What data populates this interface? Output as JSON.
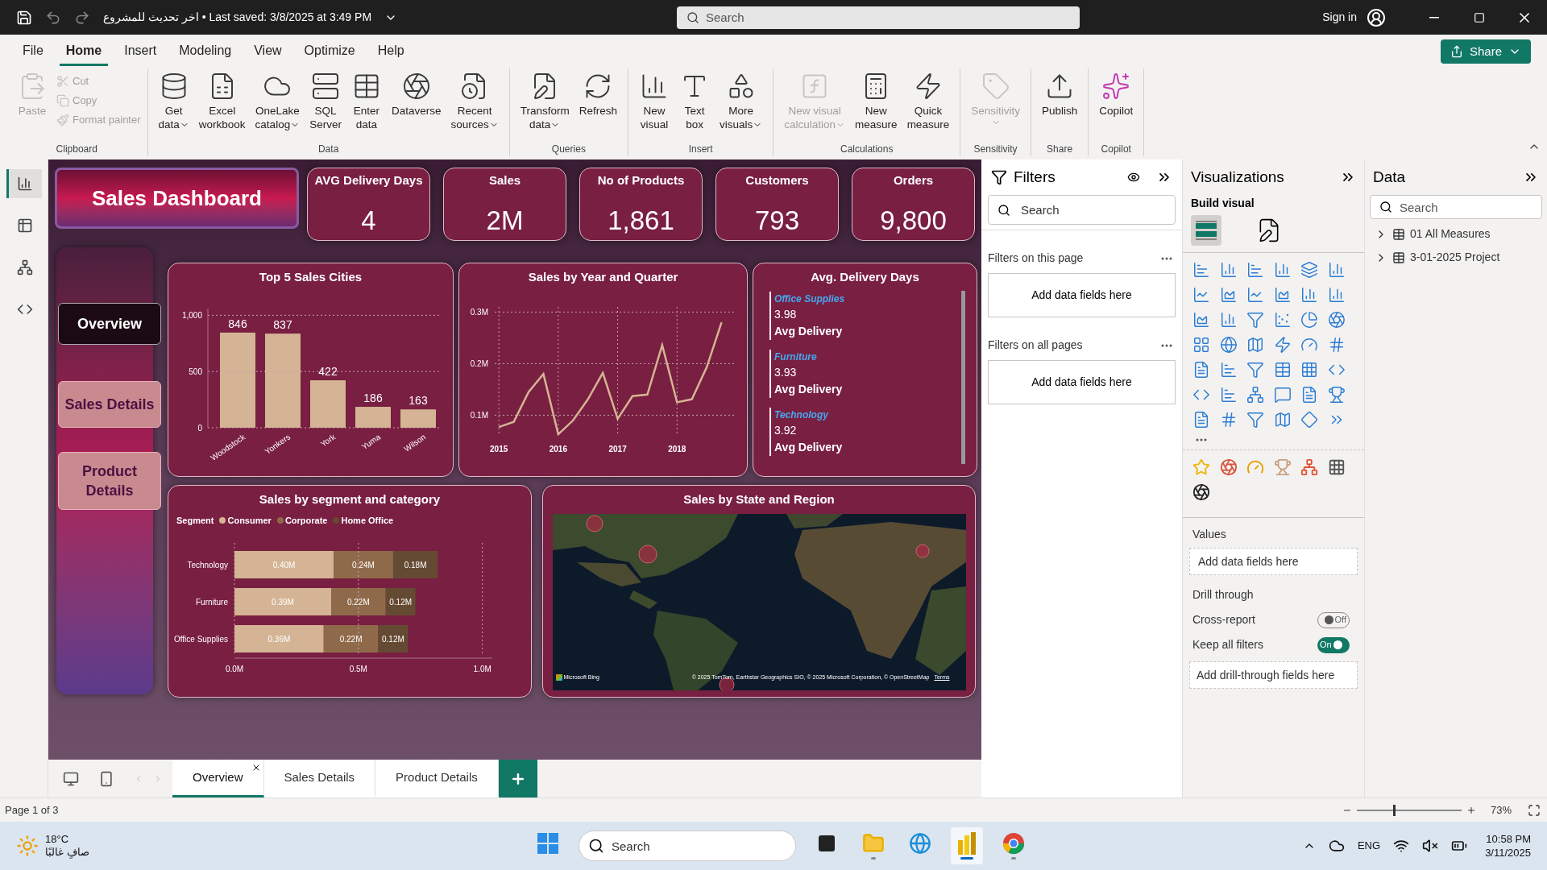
{
  "title_bar": {
    "doc_title": "اخر تحديث للمشروع • Last saved: 3/8/2025 at 3:49 PM",
    "search_placeholder": "Search",
    "sign_in": "Sign in"
  },
  "menu_tabs": [
    {
      "label": "File",
      "selected": false
    },
    {
      "label": "Home",
      "selected": true
    },
    {
      "label": "Insert",
      "selected": false
    },
    {
      "label": "Modeling",
      "selected": false
    },
    {
      "label": "View",
      "selected": false
    },
    {
      "label": "Optimize",
      "selected": false
    },
    {
      "label": "Help",
      "selected": false
    }
  ],
  "share_button": "Share",
  "ribbon": [
    {
      "group": "Clipboard",
      "items": [
        {
          "kind": "large",
          "lines": [
            "Paste"
          ],
          "menu": false,
          "disabled": true
        },
        {
          "kind": "small",
          "lines": [
            "Cut"
          ],
          "menu": false,
          "disabled": true
        },
        {
          "kind": "small",
          "lines": [
            "Copy"
          ],
          "menu": false,
          "disabled": true
        },
        {
          "kind": "small",
          "lines": [
            "Format painter"
          ],
          "menu": false,
          "disabled": true
        }
      ]
    },
    {
      "group": "Data",
      "items": [
        {
          "kind": "large",
          "lines": [
            "Get",
            "data"
          ],
          "menu": true,
          "disabled": false
        },
        {
          "kind": "large",
          "lines": [
            "Excel",
            "workbook"
          ],
          "menu": false,
          "disabled": false
        },
        {
          "kind": "large",
          "lines": [
            "OneLake",
            "catalog"
          ],
          "menu": true,
          "disabled": false
        },
        {
          "kind": "large",
          "lines": [
            "SQL",
            "Server"
          ],
          "menu": false,
          "disabled": false
        },
        {
          "kind": "large",
          "lines": [
            "Enter",
            "data"
          ],
          "menu": false,
          "disabled": false
        },
        {
          "kind": "large",
          "lines": [
            "Dataverse"
          ],
          "menu": false,
          "disabled": false
        },
        {
          "kind": "large",
          "lines": [
            "Recent",
            "sources"
          ],
          "menu": true,
          "disabled": false
        }
      ]
    },
    {
      "group": "Queries",
      "items": [
        {
          "kind": "large",
          "lines": [
            "Transform",
            "data"
          ],
          "menu": true,
          "disabled": false
        },
        {
          "kind": "large",
          "lines": [
            "Refresh"
          ],
          "menu": false,
          "disabled": false
        }
      ]
    },
    {
      "group": "Insert",
      "items": [
        {
          "kind": "large",
          "lines": [
            "New",
            "visual"
          ],
          "menu": false,
          "disabled": false
        },
        {
          "kind": "large",
          "lines": [
            "Text",
            "box"
          ],
          "menu": false,
          "disabled": false
        },
        {
          "kind": "large",
          "lines": [
            "More",
            "visuals"
          ],
          "menu": true,
          "disabled": false
        }
      ]
    },
    {
      "group": "Calculations",
      "items": [
        {
          "kind": "large",
          "lines": [
            "New visual",
            "calculation"
          ],
          "menu": true,
          "disabled": true
        },
        {
          "kind": "large",
          "lines": [
            "New",
            "measure"
          ],
          "menu": false,
          "disabled": false
        },
        {
          "kind": "large",
          "lines": [
            "Quick",
            "measure"
          ],
          "menu": false,
          "disabled": false
        }
      ]
    },
    {
      "group": "Sensitivity",
      "items": [
        {
          "kind": "large",
          "lines": [
            "Sensitivity"
          ],
          "menu": true,
          "disabled": true
        }
      ]
    },
    {
      "group": "Share",
      "items": [
        {
          "kind": "large",
          "lines": [
            "Publish"
          ],
          "menu": false,
          "disabled": false
        }
      ]
    },
    {
      "group": "Copilot",
      "items": [
        {
          "kind": "large",
          "lines": [
            "Copilot"
          ],
          "menu": false,
          "disabled": false
        }
      ]
    }
  ],
  "left_rail": [
    {
      "selected": true
    },
    {
      "selected": false
    },
    {
      "selected": false
    },
    {
      "selected": false
    }
  ],
  "report": {
    "title": "Sales Dashboard",
    "nav": [
      {
        "label": "Overview",
        "selected": true
      },
      {
        "label": "Sales Details",
        "selected": false
      },
      {
        "label": "Product Details",
        "selected": false
      }
    ],
    "kpis": [
      {
        "label": "AVG Delivery Days",
        "value": "4"
      },
      {
        "label": "Sales",
        "value": "2M"
      },
      {
        "label": "No of Products",
        "value": "1,861"
      },
      {
        "label": "Customers",
        "value": "793"
      },
      {
        "label": "Orders",
        "value": "9,800"
      }
    ],
    "top_cities": {
      "title": "Top 5 Sales Cities",
      "chart_data": {
        "type": "bar",
        "categories": [
          "Woodstock",
          "Yonkers",
          "York",
          "Yuma",
          "Wilson"
        ],
        "values": [
          846,
          837,
          422,
          186,
          163
        ],
        "yticks": [
          0,
          500,
          {
            "value": 1000,
            "label": "1,000"
          }
        ],
        "ylim": [
          0,
          1060
        ],
        "grid": true,
        "data_labels": true
      }
    },
    "sales_trend": {
      "title": "Sales by Year and Quarter",
      "chart_data": {
        "type": "line",
        "x": [
          2015,
          2015.25,
          2015.5,
          2015.75,
          2016,
          2016.25,
          2016.5,
          2016.75,
          2017,
          2017.25,
          2017.5,
          2017.75,
          2018,
          2018.25,
          2018.5,
          2018.75
        ],
        "values": [
          0.077,
          0.087,
          0.145,
          0.18,
          0.063,
          0.09,
          0.131,
          0.182,
          0.093,
          0.137,
          0.14,
          0.236,
          0.125,
          0.131,
          0.193,
          0.28
        ],
        "xticks": [
          2015,
          2016,
          2017,
          2018
        ],
        "yticks": [
          {
            "value": 0.1,
            "label": "0.1M"
          },
          {
            "value": 0.2,
            "label": "0.2M"
          },
          {
            "value": 0.3,
            "label": "0.3M"
          }
        ],
        "xlim": [
          2014.93,
          2019
        ],
        "ylim": [
          0.06,
          0.31
        ],
        "grid": true,
        "color": "#d4b494"
      }
    },
    "avg_delivery": {
      "title": "Avg. Delivery Days",
      "items": [
        {
          "category": "Office Supplies",
          "value": "3.98",
          "label": "Avg Delivery"
        },
        {
          "category": "Furniture",
          "value": "3.93",
          "label": "Avg Delivery"
        },
        {
          "category": "Technology",
          "value": "3.92",
          "label": "Avg Delivery"
        }
      ]
    },
    "segment": {
      "title": "Sales by segment and category",
      "legend_title": "Segment",
      "chart_data": {
        "type": "bar",
        "orientation": "horizontal",
        "stacked": true,
        "categories": [
          "Technology",
          "Furniture",
          "Office Supplies"
        ],
        "series": [
          {
            "name": "Consumer",
            "color": "#d4b494",
            "values": [
              0.4,
              0.39,
              0.36
            ]
          },
          {
            "name": "Corporate",
            "color": "#8f6a4a",
            "values": [
              0.24,
              0.22,
              0.22
            ]
          },
          {
            "name": "Home Office",
            "color": "#654a33",
            "values": [
              0.18,
              0.12,
              0.12
            ]
          }
        ],
        "xticks": [
          {
            "value": 0,
            "label": "0.0M"
          },
          {
            "value": 0.5,
            "label": "0.5M"
          },
          {
            "value": 1.0,
            "label": "1.0M"
          }
        ],
        "xlim": [
          0,
          1.04
        ],
        "grid": true,
        "value_labels": [
          [
            "0.40M",
            "0.39M",
            "0.36M"
          ],
          [
            "0.24M",
            "0.22M",
            "0.22M"
          ],
          [
            "0.18M",
            "0.12M",
            "0.12M"
          ]
        ]
      }
    },
    "map": {
      "title": "Sales by State and Region",
      "provider": "Microsoft Bing",
      "attribution": "© 2025 TomTom, Earthstar Geographics SIO, © 2025 Microsoft Corporation, © OpenStreetMap",
      "terms": "Terms"
    }
  },
  "page_tabs": [
    {
      "label": "Overview",
      "selected": true
    },
    {
      "label": "Sales Details",
      "selected": false
    },
    {
      "label": "Product Details",
      "selected": false
    }
  ],
  "filters": {
    "title": "Filters",
    "search_placeholder": "Search",
    "sections": [
      {
        "title": "Filters on this page",
        "well": "Add data fields here"
      },
      {
        "title": "Filters on all pages",
        "well": "Add data fields here"
      }
    ]
  },
  "visualizations": {
    "title": "Visualizations",
    "subtitle": "Build visual",
    "wells": [
      {
        "title": "Values",
        "well": "Add data fields here"
      }
    ],
    "drill_title": "Drill through",
    "toggles": [
      {
        "label": "Cross-report",
        "on": false,
        "state_text": "Off"
      },
      {
        "label": "Keep all filters",
        "on": true,
        "state_text": "On"
      }
    ],
    "drill_well": "Add drill-through fields here"
  },
  "data_pane": {
    "title": "Data",
    "search_placeholder": "Search",
    "tables": [
      {
        "name": "01 All Measures",
        "expanded": false
      },
      {
        "name": "3-01-2025 Project",
        "expanded": false
      }
    ]
  },
  "status_bar": {
    "page": "Page 1 of 3",
    "zoom": "73%",
    "level": 0.35
  },
  "taskbar": {
    "temperature": "18°C",
    "weather": "صافٍ غالبًا",
    "search_placeholder": "Search",
    "apps": [
      {
        "active": false,
        "running": false
      },
      {
        "active": false,
        "running": false
      },
      {
        "active": false,
        "running": true
      },
      {
        "active": false,
        "running": false
      },
      {
        "active": true,
        "running": true
      },
      {
        "active": false,
        "running": true
      }
    ],
    "language": "ENG",
    "time": "10:58 PM",
    "date": "3/11/2025"
  }
}
